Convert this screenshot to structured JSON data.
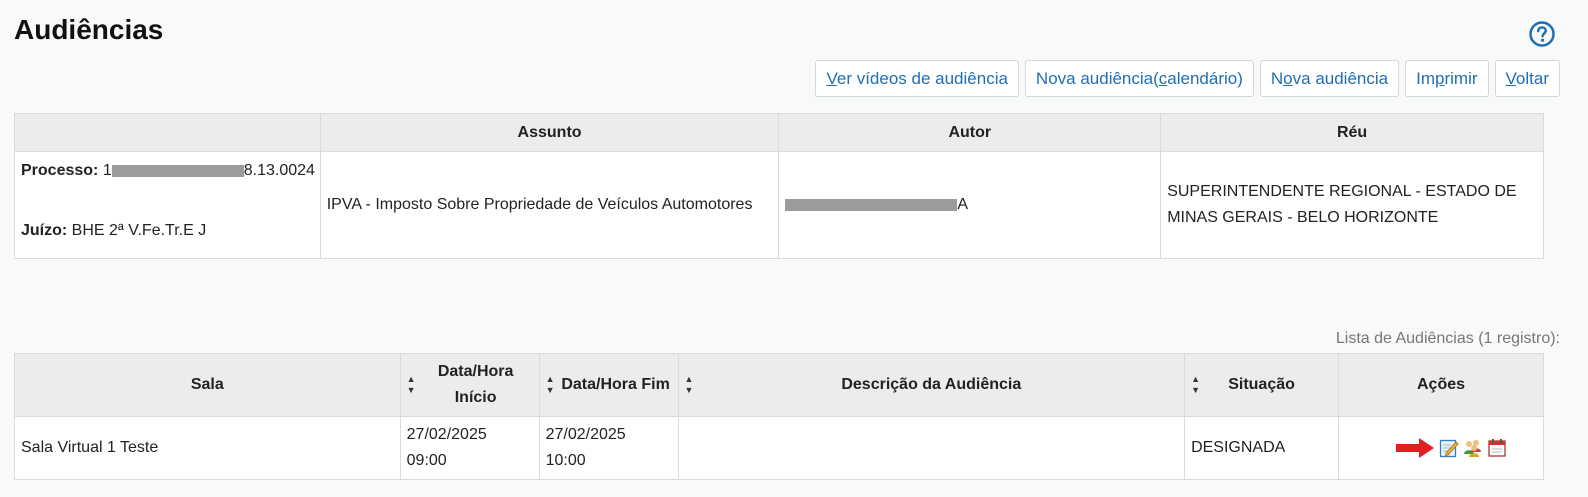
{
  "header": {
    "title": "Audiências",
    "help_icon": "help-circle-icon"
  },
  "toolbar": {
    "buttons": [
      {
        "prefix": "",
        "mnemonic": "V",
        "suffix": "er vídeos de audiência"
      },
      {
        "prefix": "Nova audiência(",
        "mnemonic": "c",
        "suffix": "alendário)"
      },
      {
        "prefix": "N",
        "mnemonic": "o",
        "suffix": "va audiência"
      },
      {
        "prefix": "Im",
        "mnemonic": "p",
        "suffix": "rimir"
      },
      {
        "prefix": "",
        "mnemonic": "V",
        "suffix": "oltar"
      }
    ]
  },
  "process_info": {
    "columns": [
      "",
      "Assunto",
      "Autor",
      "Réu"
    ],
    "processo_label": "Processo:",
    "processo_visible_prefix": "1",
    "processo_visible_suffix": "8.13.0024",
    "juizo_label": "Juízo:",
    "juizo_value": "BHE 2ª V.Fe.Tr.E J",
    "assunto": "IPVA - Imposto Sobre Propriedade de Veículos Automotores",
    "autor_suffix": "A",
    "reu": "SUPERINTENDENTE REGIONAL - ESTADO DE MINAS GERAIS - BELO HORIZONTE"
  },
  "hearings": {
    "count_label": "Lista de Audiências (1 registro):",
    "columns": {
      "sala": "Sala",
      "inicio_line1": "Data/Hora",
      "inicio_line2": "Início",
      "fim": "Data/Hora Fim",
      "descricao": "Descrição da Audiência",
      "situacao": "Situação",
      "acoes": "Ações"
    },
    "rows": [
      {
        "sala": "Sala Virtual 1 Teste",
        "inicio_date": "27/02/2025",
        "inicio_time": "09:00",
        "fim_date": "27/02/2025",
        "fim_time": "10:00",
        "descricao": "",
        "situacao": "DESIGNADA",
        "actions": [
          "edit-note-icon",
          "participants-icon",
          "calendar-icon"
        ]
      }
    ]
  },
  "colors": {
    "link": "#1f6fb4",
    "header_bg": "#ececed",
    "arrow": "#e02020"
  }
}
